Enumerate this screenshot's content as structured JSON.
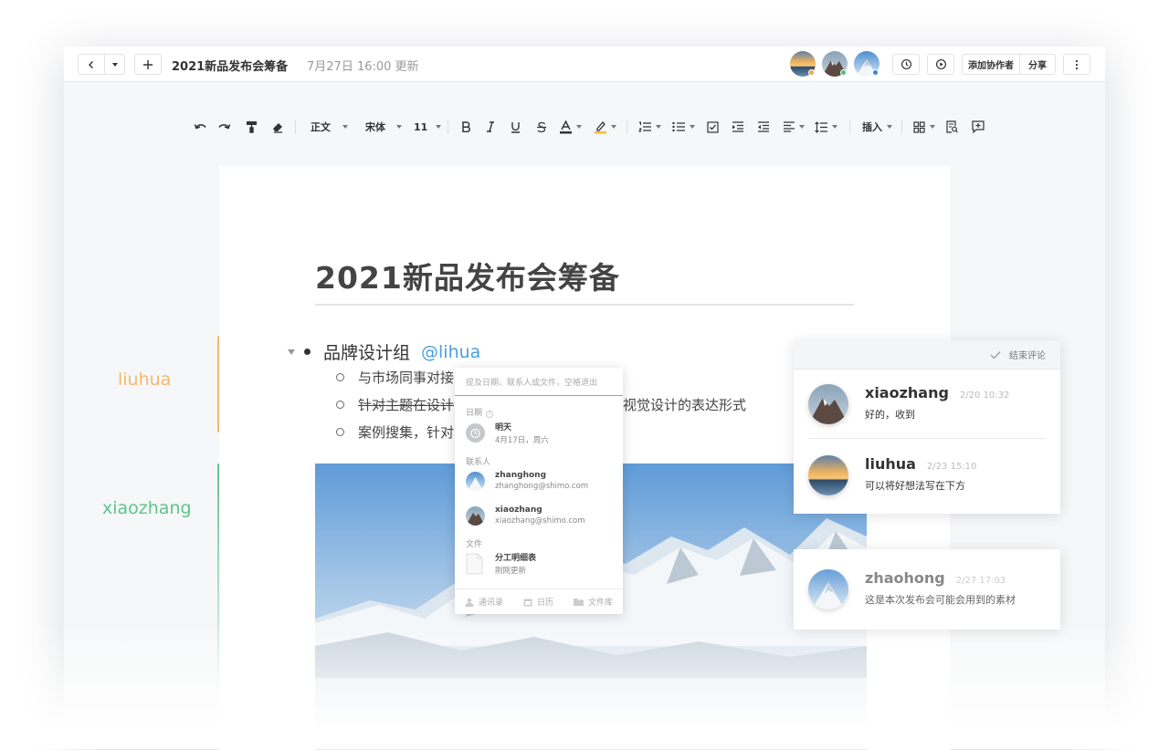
{
  "topbar": {
    "doc_title": "2021新品发布会筹备",
    "updated": "7月27日 16:00 更新",
    "add_collaborator": "添加协作者",
    "share": "分享"
  },
  "toolbar": {
    "style": "正文",
    "font": "宋体",
    "size": "11",
    "insert": "插入"
  },
  "document": {
    "title": "2021新品发布会筹备",
    "bullet": "品牌设计组",
    "mention": "@lihua",
    "items": [
      "与市场同事对接",
      "针对主题在设计",
      "视觉设计的表达形式",
      "案例搜集，针对"
    ]
  },
  "margin": {
    "user1": "liuhua",
    "user2": "xiaozhang"
  },
  "popup": {
    "placeholder": "提及日期、联系人或文件，空格退出",
    "date_section": "日期",
    "date_title": "明天",
    "date_sub": "4月17日，周六",
    "contact_section": "联系人",
    "contacts": [
      {
        "name": "zhanghong",
        "email": "zhanghong@shimo.com"
      },
      {
        "name": "xiaozhang",
        "email": "xiaozhang@shimo.com"
      }
    ],
    "file_section": "文件",
    "file_name": "分工明细表",
    "file_sub": "刚刚更新",
    "footer": [
      "通讯录",
      "日历",
      "文件库"
    ]
  },
  "comments": {
    "resolve": "结束评论",
    "items": [
      {
        "name": "xiaozhang",
        "time": "2/20 10:32",
        "text": "好的，收到"
      },
      {
        "name": "liuhua",
        "time": "2/23 15:10",
        "text": "可以将好想法写在下方"
      },
      {
        "name": "zhaohong",
        "time": "2/27 17:03",
        "text": "这是本次发布会可能会用到的素材"
      }
    ]
  },
  "colors": {
    "liuhua": "#f4b86a",
    "xiaozhang": "#5ec48a",
    "mention": "#4a9fe0"
  }
}
